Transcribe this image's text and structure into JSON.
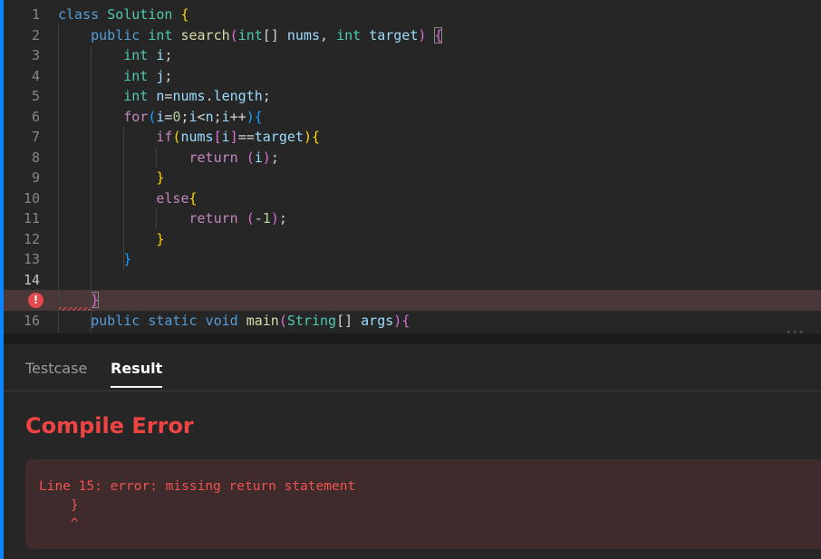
{
  "editor": {
    "lines": [
      {
        "n": "1",
        "tokens": [
          [
            "class ",
            "k"
          ],
          [
            "Solution ",
            "t"
          ],
          [
            "{",
            "b1"
          ]
        ]
      },
      {
        "n": "2",
        "tokens": [
          [
            "    ",
            "p"
          ],
          [
            "public ",
            "k"
          ],
          [
            "int ",
            "t"
          ],
          [
            "search",
            "f"
          ],
          [
            "(",
            "b2"
          ],
          [
            "int",
            "t"
          ],
          [
            "[] ",
            "p"
          ],
          [
            "nums",
            "v"
          ],
          [
            ", ",
            "p"
          ],
          [
            "int ",
            "t"
          ],
          [
            "target",
            "v"
          ],
          [
            ") ",
            "b2"
          ],
          [
            "{",
            "b2 bm"
          ]
        ]
      },
      {
        "n": "3",
        "tokens": [
          [
            "        ",
            "p"
          ],
          [
            "int ",
            "t"
          ],
          [
            "i",
            "v"
          ],
          [
            ";",
            "p"
          ]
        ]
      },
      {
        "n": "4",
        "tokens": [
          [
            "        ",
            "p"
          ],
          [
            "int ",
            "t"
          ],
          [
            "j",
            "v"
          ],
          [
            ";",
            "p"
          ]
        ]
      },
      {
        "n": "5",
        "tokens": [
          [
            "        ",
            "p"
          ],
          [
            "int ",
            "t"
          ],
          [
            "n",
            "v"
          ],
          [
            "=",
            "p"
          ],
          [
            "nums",
            "v"
          ],
          [
            ".",
            "p"
          ],
          [
            "length",
            "v"
          ],
          [
            ";",
            "p"
          ]
        ]
      },
      {
        "n": "6",
        "tokens": [
          [
            "        ",
            "p"
          ],
          [
            "for",
            "c"
          ],
          [
            "(",
            "b3"
          ],
          [
            "i",
            "v"
          ],
          [
            "=",
            "p"
          ],
          [
            "0",
            "n"
          ],
          [
            ";",
            "p"
          ],
          [
            "i",
            "v"
          ],
          [
            "<",
            "p"
          ],
          [
            "n",
            "v"
          ],
          [
            ";",
            "p"
          ],
          [
            "i",
            "v"
          ],
          [
            "++",
            "p"
          ],
          [
            ")",
            "b3"
          ],
          [
            "{",
            "b3"
          ]
        ]
      },
      {
        "n": "7",
        "tokens": [
          [
            "            ",
            "p"
          ],
          [
            "if",
            "c"
          ],
          [
            "(",
            "b1"
          ],
          [
            "nums",
            "v"
          ],
          [
            "[",
            "b2"
          ],
          [
            "i",
            "v"
          ],
          [
            "]",
            "b2"
          ],
          [
            "==",
            "p"
          ],
          [
            "target",
            "v"
          ],
          [
            ")",
            "b1"
          ],
          [
            "{",
            "b1"
          ]
        ]
      },
      {
        "n": "8",
        "tokens": [
          [
            "                ",
            "p"
          ],
          [
            "return ",
            "c"
          ],
          [
            "(",
            "b2"
          ],
          [
            "i",
            "v"
          ],
          [
            ")",
            "b2"
          ],
          [
            ";",
            "p"
          ]
        ]
      },
      {
        "n": "9",
        "tokens": [
          [
            "            ",
            "p"
          ],
          [
            "}",
            "b1"
          ]
        ]
      },
      {
        "n": "10",
        "tokens": [
          [
            "            ",
            "p"
          ],
          [
            "else",
            "c"
          ],
          [
            "{",
            "b1"
          ]
        ]
      },
      {
        "n": "11",
        "tokens": [
          [
            "                ",
            "p"
          ],
          [
            "return ",
            "c"
          ],
          [
            "(",
            "b2"
          ],
          [
            "-",
            "p"
          ],
          [
            "1",
            "n"
          ],
          [
            ")",
            "b2"
          ],
          [
            ";",
            "p"
          ]
        ]
      },
      {
        "n": "12",
        "tokens": [
          [
            "            ",
            "p"
          ],
          [
            "}",
            "b1"
          ]
        ]
      },
      {
        "n": "13",
        "tokens": [
          [
            "        ",
            "p"
          ],
          [
            "}",
            "b3"
          ]
        ]
      },
      {
        "n": "14",
        "tokens": []
      },
      {
        "n": "15",
        "error": true,
        "tokens": [
          [
            "    ",
            "p"
          ],
          [
            "}",
            "b2 bm"
          ]
        ]
      },
      {
        "n": "16",
        "tokens": [
          [
            "    ",
            "p"
          ],
          [
            "public ",
            "k"
          ],
          [
            "static ",
            "k"
          ],
          [
            "void ",
            "k"
          ],
          [
            "main",
            "f"
          ],
          [
            "(",
            "b2"
          ],
          [
            "String",
            "t"
          ],
          [
            "[] ",
            "p"
          ],
          [
            "args",
            "v"
          ],
          [
            ")",
            "b2"
          ],
          [
            "{",
            "b2"
          ]
        ]
      }
    ],
    "error_icon": "error-icon",
    "error_icon_glyph": "!"
  },
  "tabs": [
    {
      "label": "Testcase"
    },
    {
      "label": "Result",
      "active": true
    }
  ],
  "result": {
    "title": "Compile Error",
    "message": "Line 15: error: missing return statement\n    }\n    ^"
  },
  "colors": {
    "accent": "#0a84ff",
    "error": "#ef4444",
    "error_bg": "#3f2b2b"
  }
}
